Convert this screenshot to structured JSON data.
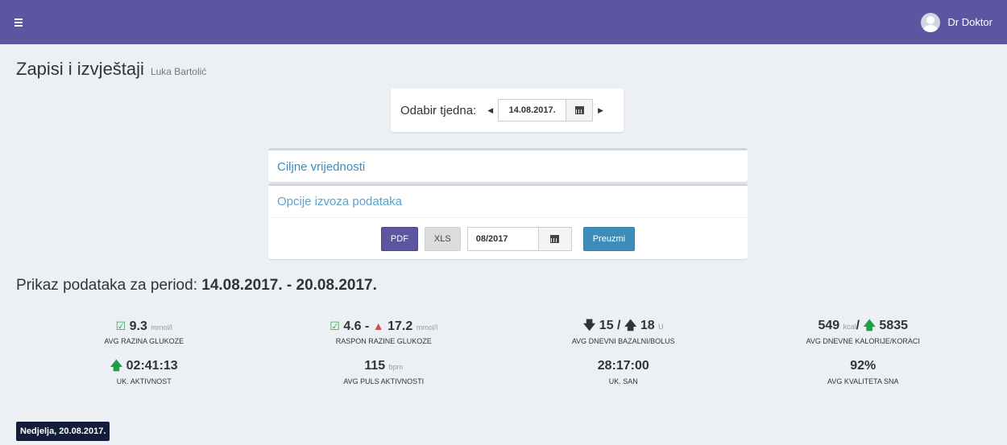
{
  "header": {
    "user_name": "Dr Doktor"
  },
  "page": {
    "title": "Zapisi i izvještaji",
    "patient": "Luka Bartolić"
  },
  "week_select": {
    "label": "Odabir tjedna:",
    "date": "14.08.2017."
  },
  "panels": {
    "targets_title": "Ciljne vrijednosti",
    "export_title": "Opcije izvoza podataka",
    "pdf_label": "PDF",
    "xls_label": "XLS",
    "month": "08/2017",
    "download_label": "Preuzmi"
  },
  "period": {
    "prefix": "Prikaz podataka za period:",
    "range": "14.08.2017. - 20.08.2017."
  },
  "stats": {
    "glucose_avg": {
      "value": "9.3",
      "unit": "mmol/l",
      "label": "AVG RAZINA GLUKOZE"
    },
    "glucose_range": {
      "low": "4.6",
      "sep": "-",
      "high": "17.2",
      "unit": "mmol/l",
      "label": "RASPON RAZINE GLUKOZE"
    },
    "insulin": {
      "basal": "15",
      "slash": "/",
      "bolus": "18",
      "unit": "U",
      "label": "AVG DNEVNI BAZALNI/BOLUS"
    },
    "calories": {
      "kcal": "549",
      "kcal_unit": "kcal",
      "slash": "/",
      "steps": "5835",
      "label": "AVG DNEVNE KALORIJE/KORACI"
    },
    "activity": {
      "value": "02:41:13",
      "label": "UK. AKTIVNOST"
    },
    "pulse": {
      "value": "115",
      "unit": "bpm",
      "label": "AVG PULS AKTIVNOSTI"
    },
    "sleep": {
      "value": "28:17:00",
      "label": "UK. SAN"
    },
    "sleep_quality": {
      "value": "92%",
      "label": "AVG KVALITETA SNA"
    }
  },
  "day": {
    "label": "Nedjelja, 20.08.2017."
  },
  "colors": {
    "topbar": "#5c55a0",
    "accent_blue": "#3c8dbc",
    "ok_green": "#2ea44f",
    "warn_red": "#dd4b39"
  },
  "icons": [
    "menu-icon",
    "user-avatar-icon",
    "caret-left-icon",
    "caret-right-icon",
    "calendar-icon",
    "check-square-icon",
    "warning-triangle-icon",
    "arrow-up-icon",
    "arrow-down-icon"
  ]
}
